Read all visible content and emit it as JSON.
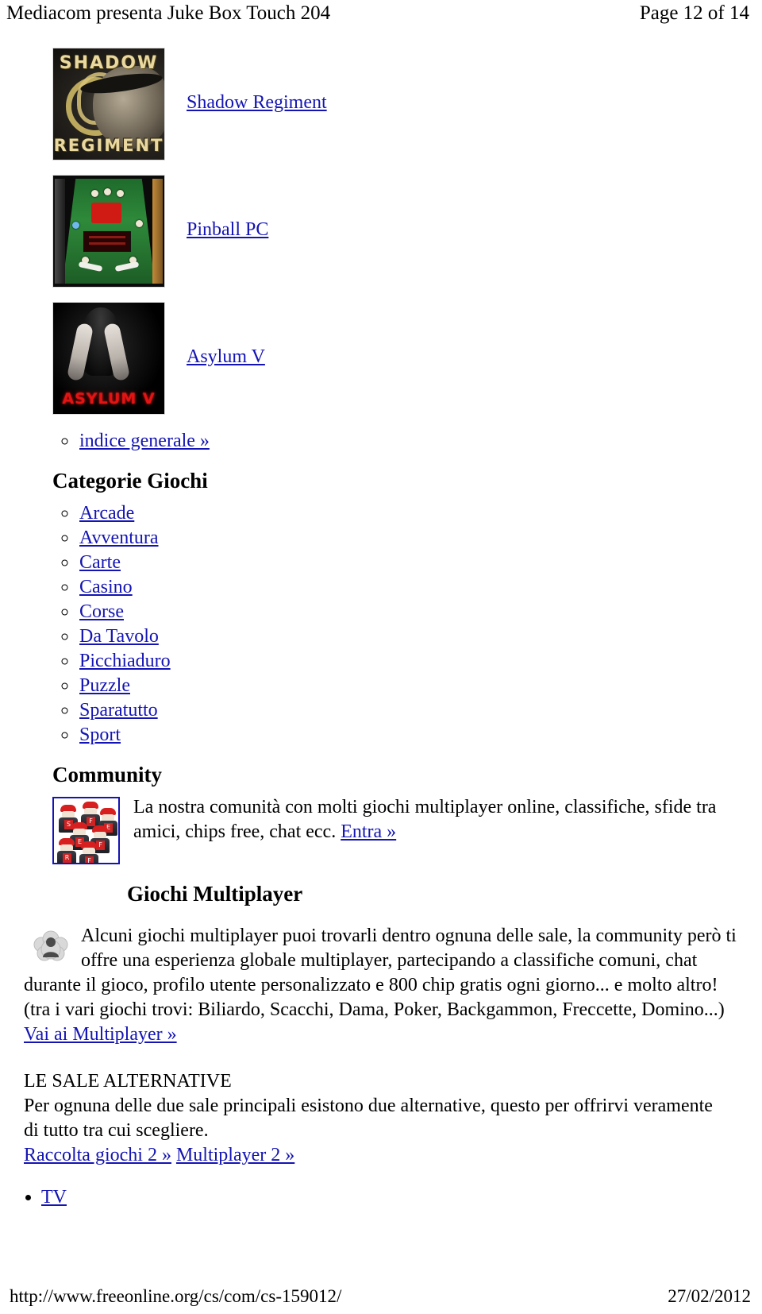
{
  "header": {
    "left_title": "Mediacom presenta Juke Box Touch 204",
    "right_page": "Page 12 of 14"
  },
  "games": [
    {
      "title": "Shadow Regiment",
      "thumb_icon": "shadow-regiment-thumbnail",
      "art_top": "SHADOW",
      "art_bottom": "REGIMENT"
    },
    {
      "title": "Pinball PC",
      "thumb_icon": "pinball-pc-thumbnail"
    },
    {
      "title": "Asylum V",
      "thumb_icon": "asylum-v-thumbnail",
      "art_title": "ASYLUM V"
    }
  ],
  "index_link": "indice generale »",
  "categories": {
    "heading": "Categorie Giochi",
    "items": [
      "Arcade",
      "Avventura",
      "Carte",
      "Casino",
      "Corse",
      "Da Tavolo",
      "Picchiaduro",
      "Puzzle",
      "Sparatutto",
      "Sport"
    ]
  },
  "community": {
    "heading": "Community",
    "thumb_icon": "community-crowd-thumbnail",
    "text": "La nostra comunità con molti giochi multiplayer online, classifiche, sfide tra amici, chips free, chat ecc.",
    "link": "Entra »"
  },
  "multiplayer": {
    "heading": "Giochi Multiplayer",
    "avatar_icon": "user-avatar-icon",
    "paragraph_line1": "Alcuni giochi multiplayer puoi trovarli dentro ognuna delle sale, la community però ti",
    "paragraph_line2": "offre una esperienza globale multiplayer, partecipando a classifiche comuni, chat",
    "paragraph_line3": "durante il gioco, profilo utente personalizzato e 800 chip gratis ogni giorno... e molto altro!",
    "paragraph_line4": "(tra i vari giochi trovi: Biliardo, Scacchi, Dama, Poker, Backgammon, Freccette, Domino...)",
    "link": "Vai ai Multiplayer »"
  },
  "alternatives": {
    "heading": "LE SALE ALTERNATIVE",
    "line1": "Per ognuna delle due sale principali esistono due alternative, questo per offrirvi veramente",
    "line2": "di tutto tra cui scegliere.",
    "link_collection": "Raccolta giochi 2 »",
    "link_multiplayer": "Multiplayer 2 »"
  },
  "tv_link": "TV",
  "footer": {
    "url": "http://www.freeonline.org/cs/com/cs-159012/",
    "date": "27/02/2012"
  },
  "colors": {
    "link": "#1414b4",
    "text": "#000000",
    "background": "#ffffff"
  }
}
